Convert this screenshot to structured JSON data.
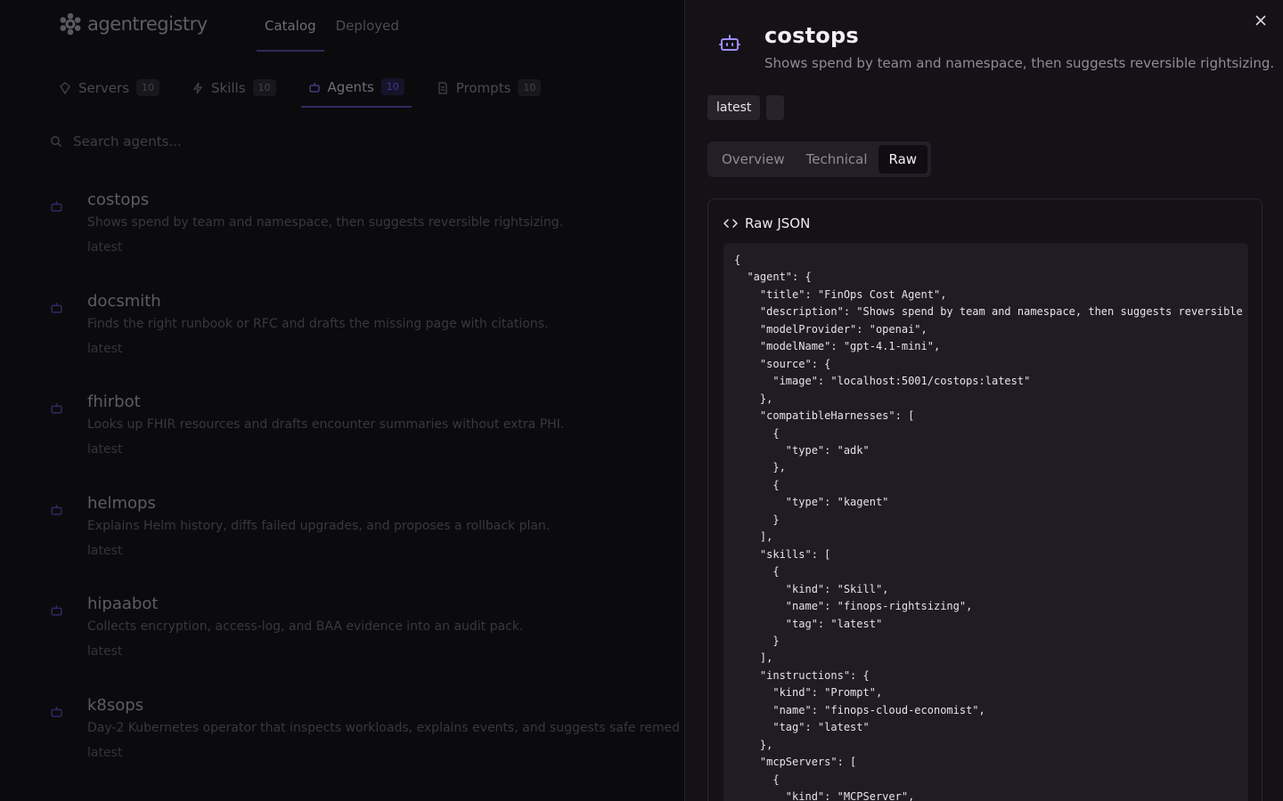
{
  "app": {
    "logo_text": "agentregistry",
    "nav": [
      {
        "label": "Catalog",
        "active": true
      },
      {
        "label": "Deployed",
        "active": false
      }
    ]
  },
  "tabs": [
    {
      "label": "Servers",
      "count": "10",
      "icon": "server-icon"
    },
    {
      "label": "Skills",
      "count": "10",
      "icon": "bolt-icon"
    },
    {
      "label": "Agents",
      "count": "10",
      "icon": "bot-icon",
      "active": true
    },
    {
      "label": "Prompts",
      "count": "10",
      "icon": "document-icon"
    }
  ],
  "search": {
    "placeholder": "Search agents..."
  },
  "agents": [
    {
      "name": "costops",
      "description": "Shows spend by team and namespace, then suggests reversible rightsizing.",
      "tag": "latest"
    },
    {
      "name": "docsmith",
      "description": "Finds the right runbook or RFC and drafts the missing page with citations.",
      "tag": "latest"
    },
    {
      "name": "fhirbot",
      "description": "Looks up FHIR resources and drafts encounter summaries without extra PHI.",
      "tag": "latest"
    },
    {
      "name": "helmops",
      "description": "Explains Helm history, diffs failed upgrades, and proposes a rollback plan.",
      "tag": "latest"
    },
    {
      "name": "hipaabot",
      "description": "Collects encryption, access-log, and BAA evidence into an audit pack.",
      "tag": "latest"
    },
    {
      "name": "k8sops",
      "description": "Day-2 Kubernetes operator that inspects workloads, explains events, and suggests safe remed",
      "tag": "latest"
    },
    {
      "name": "",
      "description": "",
      "tag": ""
    }
  ],
  "drawer": {
    "title": "costops",
    "description": "Shows spend by team and namespace, then suggests reversible rightsizing.",
    "tags": [
      "latest",
      ""
    ],
    "tabs": [
      {
        "label": "Overview",
        "active": false
      },
      {
        "label": "Technical",
        "active": false
      },
      {
        "label": "Raw",
        "active": true
      }
    ],
    "raw_heading": "Raw JSON",
    "raw_json": "{\n  \"agent\": {\n    \"title\": \"FinOps Cost Agent\",\n    \"description\": \"Shows spend by team and namespace, then suggests reversible\n    \"modelProvider\": \"openai\",\n    \"modelName\": \"gpt-4.1-mini\",\n    \"source\": {\n      \"image\": \"localhost:5001/costops:latest\"\n    },\n    \"compatibleHarnesses\": [\n      {\n        \"type\": \"adk\"\n      },\n      {\n        \"type\": \"kagent\"\n      }\n    ],\n    \"skills\": [\n      {\n        \"kind\": \"Skill\",\n        \"name\": \"finops-rightsizing\",\n        \"tag\": \"latest\"\n      }\n    ],\n    \"instructions\": {\n      \"kind\": \"Prompt\",\n      \"name\": \"finops-cloud-economist\",\n      \"tag\": \"latest\"\n    },\n    \"mcpServers\": [\n      {\n        \"kind\": \"MCPServer\","
  },
  "colors": {
    "accent": "#7b6cf6",
    "drawer_bg": "#141117",
    "page_bg": "#0b0b0d"
  }
}
